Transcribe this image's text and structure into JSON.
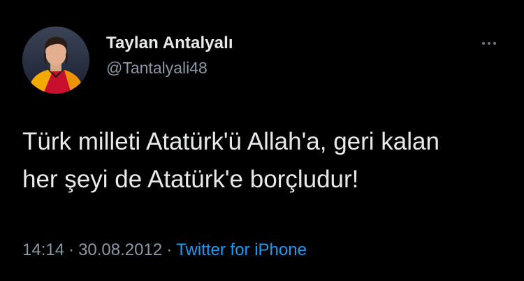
{
  "tweet": {
    "author": {
      "display_name": "Taylan Antalyalı",
      "handle": "@Tantalyali48",
      "avatar_icon": "profile-photo"
    },
    "more_icon": "more-horizontal-icon",
    "text_lines": [
      "Türk milleti Atatürk'ü Allah'a, geri kalan",
      "her şeyi de Atatürk'e borçludur!"
    ],
    "time": "14:14",
    "separator": "·",
    "date": "30.08.2012",
    "source": "Twitter for iPhone"
  },
  "colors": {
    "background": "#000000",
    "primary_text": "#e7e9ea",
    "secondary_text": "#8b98a5",
    "link": "#1d9bf0",
    "jersey_red": "#c8102e",
    "jersey_yellow": "#f2a900"
  }
}
